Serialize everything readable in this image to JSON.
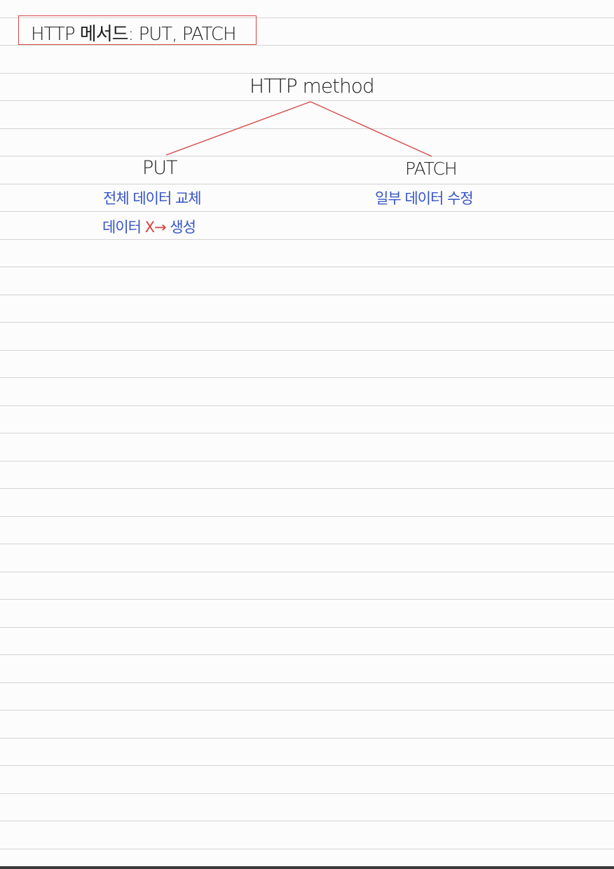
{
  "note_title": "HTTP 메서드: PUT, PATCH",
  "tree": {
    "root": "HTTP method",
    "left": {
      "label": "PUT",
      "notes": {
        "line1": "전체 데이터 교체",
        "line2_prefix": "데이터",
        "line2_mark": "X",
        "line2_arrow": "→",
        "line2_suffix": "생성"
      }
    },
    "right": {
      "label": "PATCH",
      "notes": {
        "line1": "일부 데이터 수정"
      }
    }
  },
  "colors": {
    "paper": "#fcfcfc",
    "rule_line": "#d4d4d4",
    "ink_black": "#1e1e1e",
    "ink_red": "#d84a4a",
    "ink_blue": "#3655c6"
  }
}
